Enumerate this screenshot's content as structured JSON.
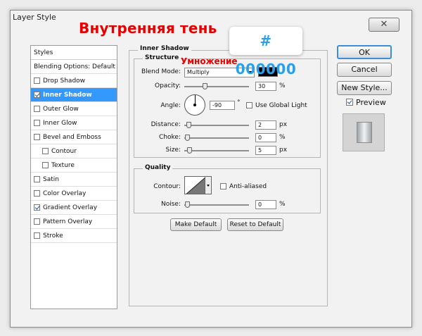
{
  "window": {
    "title": "Layer Style",
    "close_glyph": "✕"
  },
  "overlay": {
    "title_ru": "Внутренняя тень",
    "hex_color": "# 000000",
    "multiply_ru": "Умножение"
  },
  "styles_list": {
    "header": "Styles",
    "blending_options": "Blending Options: Default",
    "items": [
      {
        "label": "Drop Shadow",
        "checked": false,
        "indent": false,
        "selected": false
      },
      {
        "label": "Inner Shadow",
        "checked": true,
        "indent": false,
        "selected": true
      },
      {
        "label": "Outer Glow",
        "checked": false,
        "indent": false,
        "selected": false
      },
      {
        "label": "Inner Glow",
        "checked": false,
        "indent": false,
        "selected": false
      },
      {
        "label": "Bevel and Emboss",
        "checked": false,
        "indent": false,
        "selected": false
      },
      {
        "label": "Contour",
        "checked": false,
        "indent": true,
        "selected": false
      },
      {
        "label": "Texture",
        "checked": false,
        "indent": true,
        "selected": false
      },
      {
        "label": "Satin",
        "checked": false,
        "indent": false,
        "selected": false
      },
      {
        "label": "Color Overlay",
        "checked": false,
        "indent": false,
        "selected": false
      },
      {
        "label": "Gradient Overlay",
        "checked": true,
        "indent": false,
        "selected": false
      },
      {
        "label": "Pattern Overlay",
        "checked": false,
        "indent": false,
        "selected": false
      },
      {
        "label": "Stroke",
        "checked": false,
        "indent": false,
        "selected": false
      }
    ]
  },
  "inner_shadow": {
    "group_title": "Inner Shadow",
    "structure": {
      "title": "Structure",
      "blend_mode_label": "Blend Mode:",
      "blend_mode_value": "Multiply",
      "shadow_color": "#000000",
      "opacity_label": "Opacity:",
      "opacity_value": "30",
      "opacity_unit": "%",
      "opacity_level": 0.3,
      "angle_label": "Angle:",
      "angle_value": "90",
      "angle_unit": "°",
      "use_global_light_label": "Use Global Light",
      "use_global_light": false,
      "distance_label": "Distance:",
      "distance_value": "2",
      "distance_unit": "px",
      "distance_level": 0.02,
      "choke_label": "Choke:",
      "choke_value": "0",
      "choke_unit": "%",
      "choke_level": 0,
      "size_label": "Size:",
      "size_value": "5",
      "size_unit": "px",
      "size_level": 0.04
    },
    "quality": {
      "title": "Quality",
      "contour_label": "Contour:",
      "anti_aliased_label": "Anti-aliased",
      "anti_aliased": false,
      "noise_label": "Noise:",
      "noise_value": "0",
      "noise_unit": "%",
      "noise_level": 0
    },
    "make_default_label": "Make Default",
    "reset_default_label": "Reset to Default"
  },
  "actions": {
    "ok_label": "OK",
    "cancel_label": "Cancel",
    "new_style_label": "New Style...",
    "preview_label": "Preview",
    "preview_checked": true
  }
}
